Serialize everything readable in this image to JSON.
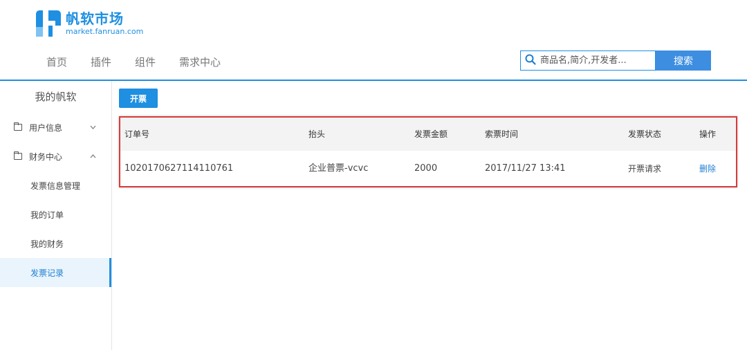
{
  "brand": {
    "name": "帆软市场",
    "domain": "market.fanruan.com",
    "color": "#1e8fe1"
  },
  "nav": {
    "items": [
      "首页",
      "插件",
      "组件",
      "需求中心"
    ]
  },
  "search": {
    "placeholder": "商品名,简介,开发者...",
    "button_label": "搜索"
  },
  "sidebar": {
    "title": "我的帆软",
    "groups": [
      {
        "label": "用户信息",
        "icon": "folder-icon",
        "chevron": "chevron-down-icon"
      },
      {
        "label": "财务中心",
        "icon": "folder-icon",
        "chevron": "chevron-up-icon"
      }
    ],
    "items": [
      {
        "label": "发票信息管理"
      },
      {
        "label": "我的订单"
      },
      {
        "label": "我的财务"
      },
      {
        "label": "发票记录",
        "active": true
      }
    ]
  },
  "main": {
    "invoice_button": "开票",
    "table": {
      "headers": [
        "订单号",
        "抬头",
        "发票金额",
        "索票时间",
        "发票状态",
        "操作"
      ],
      "rows": [
        [
          "1020170627114110761",
          "企业普票-vcvc",
          "2000",
          "2017/11/27 13:41",
          "开票请求",
          "删除"
        ]
      ]
    }
  }
}
